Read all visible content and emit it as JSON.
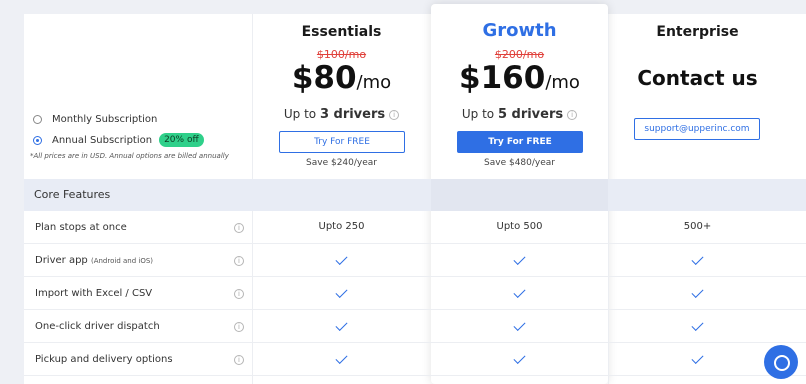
{
  "billing": {
    "monthly_label": "Monthly Subscription",
    "annual_label": "Annual Subscription",
    "discount_badge": "20% off",
    "note": "*All prices are in USD. Annual options are billed annually"
  },
  "plans": {
    "essentials": {
      "name": "Essentials",
      "old_price": "$100/mo",
      "price": "$80",
      "per": "/mo",
      "drivers_prefix": "Up to ",
      "drivers_value": "3 drivers",
      "cta": "Try For FREE",
      "save": "Save $240/year"
    },
    "growth": {
      "name": "Growth",
      "old_price": "$200/mo",
      "price": "$160",
      "per": "/mo",
      "drivers_prefix": "Up to ",
      "drivers_value": "5 drivers",
      "cta": "Try For FREE",
      "save": "Save $480/year"
    },
    "enterprise": {
      "name": "Enterprise",
      "contact": "Contact us",
      "support": "support@upperinc.com"
    }
  },
  "section": {
    "title": "Core Features"
  },
  "features": [
    {
      "label": "Plan stops at once",
      "sub": "",
      "essentials": "Upto 250",
      "growth": "Upto 500",
      "enterprise": "500+"
    },
    {
      "label": "Driver app",
      "sub": "(Android and iOS)",
      "essentials": "check",
      "growth": "check",
      "enterprise": "check"
    },
    {
      "label": "Import with Excel / CSV",
      "sub": "",
      "essentials": "check",
      "growth": "check",
      "enterprise": "check"
    },
    {
      "label": "One-click driver dispatch",
      "sub": "",
      "essentials": "check",
      "growth": "check",
      "enterprise": "check"
    },
    {
      "label": "Pickup and delivery options",
      "sub": "",
      "essentials": "check",
      "growth": "check",
      "enterprise": "check"
    }
  ],
  "colors": {
    "accent": "#2f6fe4",
    "badge": "#2fd08a",
    "strike": "#e0413b"
  }
}
